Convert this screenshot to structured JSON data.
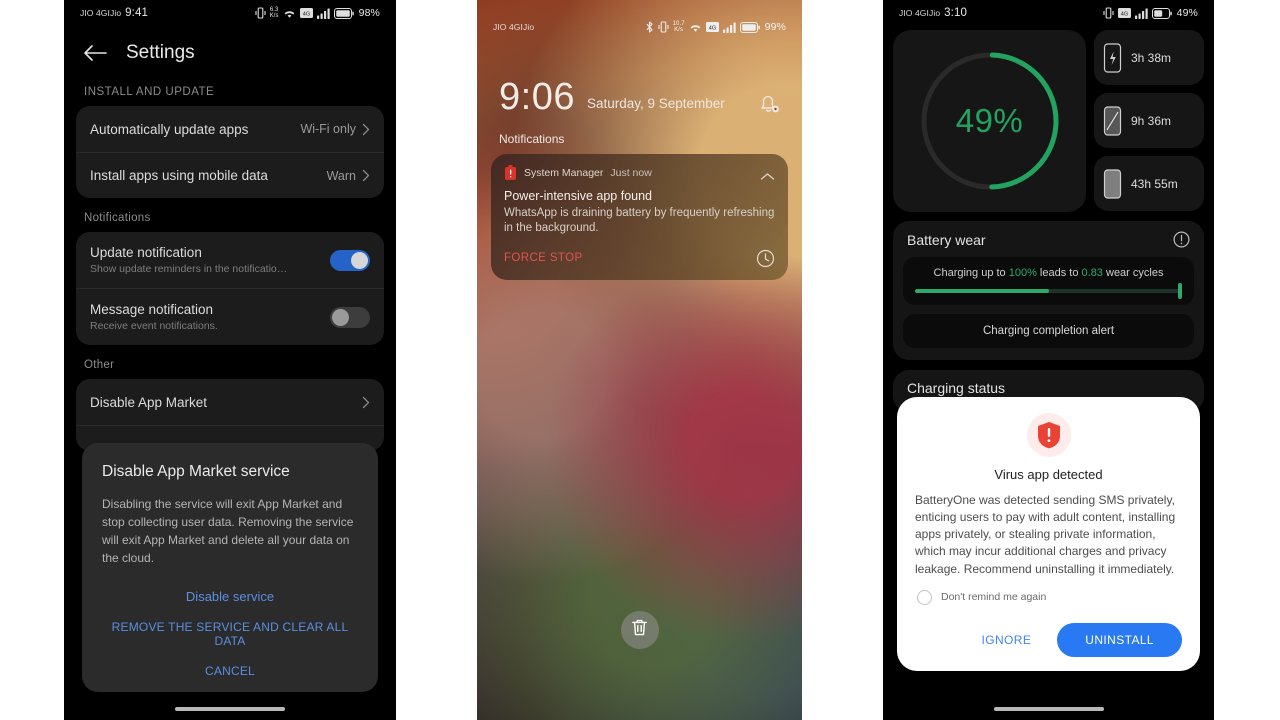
{
  "panel1": {
    "statusbar": {
      "carrier": "JIO 4GIJio",
      "time": "9:41",
      "data_rate_value": "6.3",
      "data_rate_unit": "K/s",
      "battery_percent": "98%",
      "icons": [
        "vibrate-icon",
        "data-rate-icon",
        "wifi-icon",
        "sim-signal-icon",
        "signal-bars-icon",
        "battery-icon"
      ]
    },
    "header": {
      "back": "back-arrow-icon",
      "title": "Settings"
    },
    "sections": [
      {
        "label": "INSTALL AND UPDATE",
        "rows": [
          {
            "title": "Automatically update apps",
            "value": "Wi-Fi only",
            "chevron": true
          },
          {
            "title": "Install apps using mobile data",
            "value": "Warn",
            "chevron": true
          }
        ]
      },
      {
        "label": "Notifications",
        "rows": [
          {
            "title": "Update notification",
            "subtitle": "Show update reminders in the notificatio…",
            "toggle": "on"
          },
          {
            "title": "Message notification",
            "subtitle": "Receive event notifications.",
            "toggle": "off"
          }
        ]
      },
      {
        "label": "Other",
        "rows": [
          {
            "title": "Disable App Market",
            "value": "",
            "chevron": true
          }
        ]
      }
    ],
    "dialog": {
      "title": "Disable App Market service",
      "body": "Disabling the service will exit App Market and stop collecting user data. Removing the service will exit App Market and delete all your data on the cloud.",
      "actions": [
        {
          "label": "Disable service",
          "style": "link"
        },
        {
          "label": "REMOVE THE SERVICE AND CLEAR ALL DATA",
          "style": "link-caps"
        },
        {
          "label": "CANCEL",
          "style": "link-caps"
        }
      ]
    }
  },
  "panel2": {
    "statusbar": {
      "carrier": "JIO 4GIJio",
      "data_rate_value": "10.7",
      "data_rate_unit": "K/s",
      "battery_percent": "99%",
      "icons": [
        "bluetooth-icon",
        "vibrate-icon",
        "data-rate-icon",
        "wifi-icon",
        "sim-signal-icon",
        "signal-bars-icon",
        "battery-icon"
      ]
    },
    "lockscreen": {
      "time": "9:06",
      "date": "Saturday, 9 September",
      "bell_icon": "bell-gear-icon",
      "notifications_label": "Notifications"
    },
    "notification": {
      "app_icon": "battery-alert-icon",
      "app": "System Manager",
      "when": "Just now",
      "collapse_icon": "chevron-up-icon",
      "title": "Power-intensive app found",
      "body": "WhatsApp is draining battery by frequently refreshing in the background.",
      "action": "FORCE STOP",
      "snooze_icon": "clock-icon"
    },
    "trash_button": "trash-icon"
  },
  "panel3": {
    "statusbar": {
      "carrier": "JIO 4GIJio",
      "time": "3:10",
      "battery_percent": "49%",
      "icons": [
        "vibrate-icon",
        "sim-signal-icon",
        "signal-bars-icon",
        "battery-icon"
      ]
    },
    "ring": {
      "percent_label": "49%",
      "percent_value": 49,
      "color": "#22a35f",
      "track_color": "#2a2a2a"
    },
    "tiles": [
      {
        "icon": "phone-charging-icon",
        "value": "3h 38m"
      },
      {
        "icon": "phone-screen-on-icon",
        "value": "9h 36m"
      },
      {
        "icon": "phone-standby-icon",
        "value": "43h 55m"
      }
    ],
    "battery_wear": {
      "title": "Battery wear",
      "info_icon": "info-icon",
      "text_prefix": "Charging up to ",
      "highlight_1": "100%",
      "text_middle": " leads to ",
      "highlight_2": "0.83",
      "text_suffix": " wear cycles",
      "progress_percent": 50,
      "alert_button": "Charging completion alert"
    },
    "charging_status": {
      "title": "Charging status"
    },
    "dialog": {
      "icon": "shield-alert-icon",
      "title": "Virus app detected",
      "body": "BatteryOne was detected sending SMS privately, enticing users to pay with adult content, installing apps privately, or stealing private information, which may incur additional charges and privacy leakage. Recommend uninstalling it immediately.",
      "checkbox_label": "Don't remind me again",
      "ignore_label": "IGNORE",
      "uninstall_label": "UNINSTALL",
      "accent_color": "#2979f2",
      "danger_color": "#ea4335"
    }
  }
}
